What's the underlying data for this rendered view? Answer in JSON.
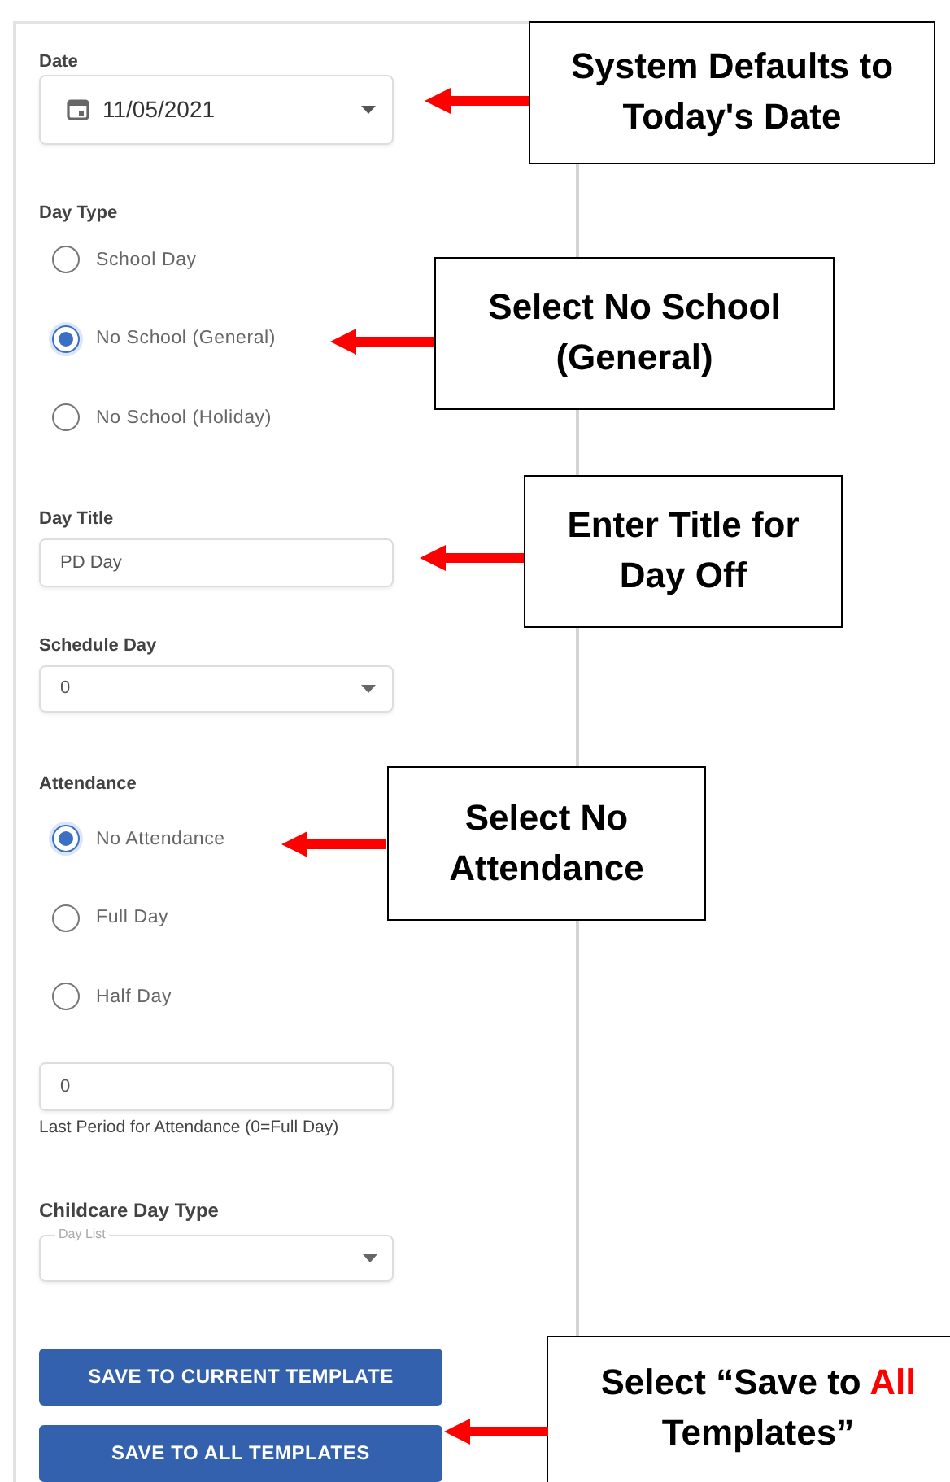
{
  "form": {
    "date": {
      "label": "Date",
      "value": "11/05/2021"
    },
    "day_type": {
      "label": "Day Type",
      "options": [
        {
          "label": "School Day",
          "selected": false
        },
        {
          "label": "No School (General)",
          "selected": true
        },
        {
          "label": "No School (Holiday)",
          "selected": false
        }
      ]
    },
    "day_title": {
      "label": "Day Title",
      "value": "PD Day"
    },
    "schedule_day": {
      "label": "Schedule Day",
      "value": "0"
    },
    "attendance": {
      "label": "Attendance",
      "options": [
        {
          "label": "No Attendance",
          "selected": true
        },
        {
          "label": "Full Day",
          "selected": false
        },
        {
          "label": "Half Day",
          "selected": false
        }
      ]
    },
    "last_period": {
      "value": "0",
      "helper": "Last Period for Attendance (0=Full Day)"
    },
    "childcare_day_type": {
      "label": "Childcare Day Type",
      "legend": "Day List"
    },
    "buttons": [
      "SAVE TO CURRENT TEMPLATE",
      "SAVE TO ALL TEMPLATES"
    ]
  },
  "callouts": [
    {
      "parts": [
        {
          "text": "System Defaults to Today's Date",
          "highlight": false
        }
      ]
    },
    {
      "parts": [
        {
          "text": "Select No School (General)",
          "highlight": false
        }
      ]
    },
    {
      "parts": [
        {
          "text": "Enter Title for Day Off",
          "highlight": false
        }
      ]
    },
    {
      "parts": [
        {
          "text": "Select No Attendance",
          "highlight": false
        }
      ]
    },
    {
      "parts": [
        {
          "text": "Select “Save to ",
          "highlight": false
        },
        {
          "text": "All",
          "highlight": true
        },
        {
          "text": " Templates”",
          "highlight": false
        }
      ]
    }
  ]
}
